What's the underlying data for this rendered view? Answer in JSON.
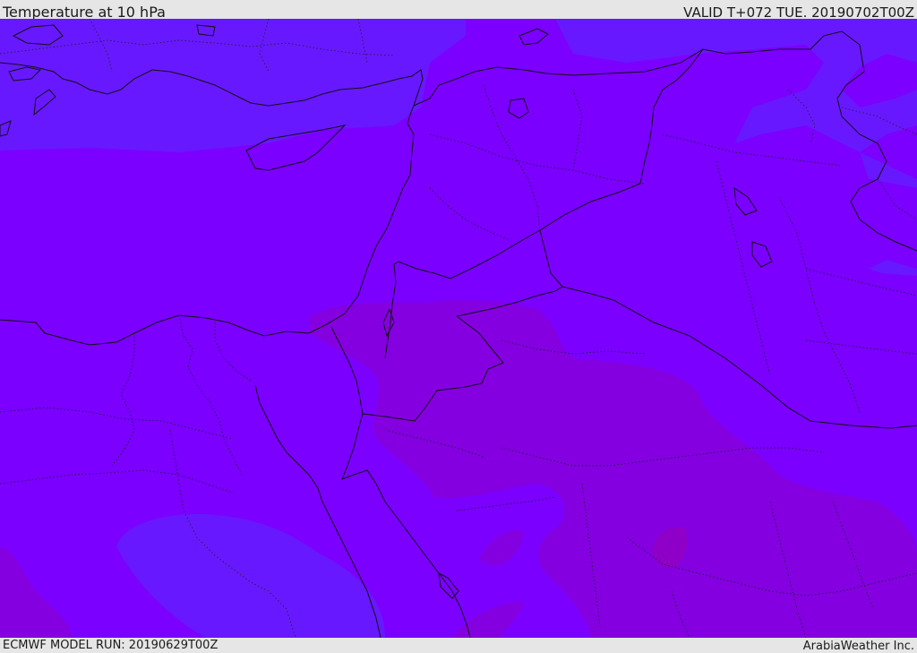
{
  "header": {
    "title": "Temperature at 10 hPa",
    "valid": "VALID T+072 TUE. 20190702T00Z"
  },
  "footer": {
    "model_run": "ECMWF MODEL RUN: 20190629T00Z",
    "credit": "ArabiaWeather Inc."
  },
  "map": {
    "colors": {
      "base": "#7b00ff",
      "cool": "#6818ff",
      "warm": "#8400e0",
      "warmer": "#8e00c8",
      "coast": "#111111",
      "border": "#1f1f40"
    }
  }
}
